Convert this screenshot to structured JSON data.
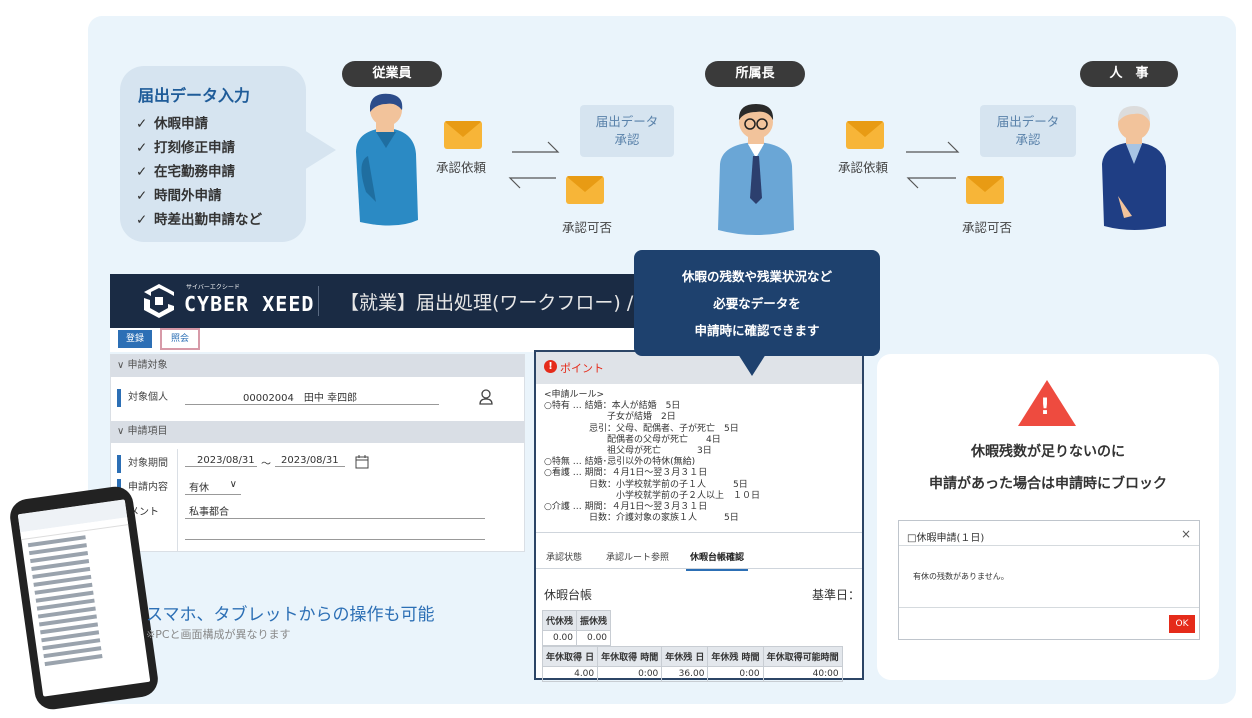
{
  "bubble": {
    "title": "届出データ入力",
    "items": [
      "休暇申請",
      "打刻修正申請",
      "在宅勤務申請",
      "時間外申請",
      "時差出勤申請など"
    ]
  },
  "flow": {
    "roles": [
      "従業員",
      "所属長",
      "人　事"
    ],
    "request_label": "承認依頼",
    "result_label": "承認可否",
    "approve_box": "届出データ\n承認"
  },
  "app": {
    "logo_kana": "サイバーエクシード",
    "logo": "CYBER XEED",
    "breadcrumb": "【就業】届出処理(ワークフロー) / ■休暇(",
    "btn_register": "登録",
    "btn_inquiry": "照会",
    "sec_target": "申請対象",
    "label_person": "対象個人",
    "person_value": "00002004　田中 幸四郎",
    "sec_items": "申請項目",
    "label_period": "対象期間",
    "date_from": "2023/08/31",
    "date_sep": "～",
    "date_to": "2023/08/31",
    "label_content": "申請内容",
    "content_value": "有休",
    "label_comment": "コメント",
    "comment_value": "私事都合"
  },
  "callout": {
    "line1": "休暇の残数や残業状況など",
    "line2": "必要なデータを",
    "line3": "申請時に確認できます"
  },
  "panel": {
    "header": "ポイント",
    "rules": "<申請ルール>\n○特有 … 結婚：本人が結婚　5日\n　　　　　　　子女が結婚　2日\n　　　　　忌引：父母、配偶者、子が死亡　5日\n　　　　　　　配偶者の父母が死亡　　4日\n　　　　　　　祖父母が死亡　　　　3日\n○特無 … 結婚･忌引以外の特休(無給)\n○看護 … 期間：４月1日～翌３月３１日\n　　　　　日数：小学校就学前の子１人　　　5日\n　　　　　　　　小学校就学前の子２人以上　１０日\n○介護 … 期間：４月1日～翌３月３１日\n　　　　　日数：介護対象の家族１人　　　5日",
    "tabs": [
      "承認状態",
      "承認ルート参照",
      "休暇台帳確認"
    ],
    "ledger_title": "休暇台帳",
    "base_date": "基準日：",
    "t1_headers": [
      "代休残",
      "振休残"
    ],
    "t1_values": [
      "0.00",
      "0.00"
    ],
    "t2_headers": [
      "年休取得 日",
      "年休取得 時間",
      "年休残 日",
      "年休残 時間",
      "年休取得可能時間"
    ],
    "t2_values": [
      "4.00",
      "0:00",
      "36.00",
      "0:00",
      "40:00"
    ]
  },
  "card": {
    "line1": "休暇残数が足りないのに",
    "line2": "申請があった場合は申請時にブロック",
    "dialog_title": "□休暇申請(１日)",
    "dialog_close": "×",
    "dialog_msg": "有休の残数がありません。",
    "ok": "OK"
  },
  "mobile": {
    "headline": "スマホ、タブレットからの操作も可能",
    "note": "※PCと画面構成が異なります"
  },
  "colors": {
    "brand": "#1a2b44",
    "accent": "#2c6fb5",
    "warn": "#ee4b3f",
    "mail": "#f7b538"
  }
}
